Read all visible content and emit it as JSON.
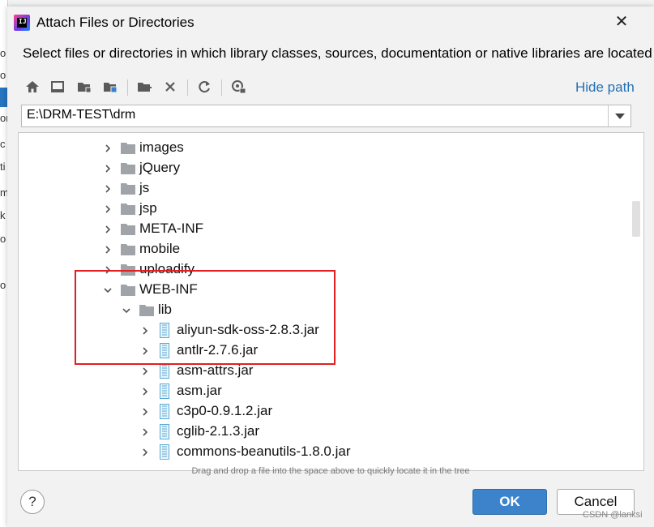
{
  "background": {
    "partial_letters": [
      "o",
      "o",
      "or",
      "c",
      "ti",
      "m",
      "k",
      "o",
      "o"
    ]
  },
  "dialog": {
    "title": "Attach Files or Directories",
    "close_glyph": "✕",
    "description": "Select files or directories in which library classes, sources, documentation or native libraries are located",
    "toolbar": {
      "icons": [
        "home-icon",
        "desktop-icon",
        "project-folder-icon",
        "module-folder-icon",
        "new-folder-icon",
        "delete-icon",
        "refresh-icon",
        "show-hidden-icon"
      ],
      "hide_path_label": "Hide path"
    },
    "path": {
      "value": "E:\\DRM-TEST\\drm"
    },
    "tree": {
      "rows": [
        {
          "label": "images",
          "type": "folder",
          "expanded": false
        },
        {
          "label": "jQuery",
          "type": "folder",
          "expanded": false
        },
        {
          "label": "js",
          "type": "folder",
          "expanded": false
        },
        {
          "label": "jsp",
          "type": "folder",
          "expanded": false
        },
        {
          "label": "META-INF",
          "type": "folder",
          "expanded": false
        },
        {
          "label": "mobile",
          "type": "folder",
          "expanded": false
        },
        {
          "label": "uploadify",
          "type": "folder",
          "expanded": false
        },
        {
          "label": "WEB-INF",
          "type": "folder",
          "expanded": true
        },
        {
          "label": "lib",
          "type": "folder",
          "expanded": true
        },
        {
          "label": "aliyun-sdk-oss-2.8.3.jar",
          "type": "jar",
          "expanded": false
        },
        {
          "label": "antlr-2.7.6.jar",
          "type": "jar",
          "expanded": false
        },
        {
          "label": "asm-attrs.jar",
          "type": "jar",
          "expanded": false
        },
        {
          "label": "asm.jar",
          "type": "jar",
          "expanded": false
        },
        {
          "label": "c3p0-0.9.1.2.jar",
          "type": "jar",
          "expanded": false
        },
        {
          "label": "cglib-2.1.3.jar",
          "type": "jar",
          "expanded": false
        },
        {
          "label": "commons-beanutils-1.8.0.jar",
          "type": "jar",
          "expanded": false
        }
      ]
    },
    "hint": "Drag and drop a file into the space above to quickly locate it in the tree",
    "help_label": "?",
    "ok_label": "OK",
    "cancel_label": "Cancel",
    "highlight_color": "#e02020"
  },
  "watermark": "CSDN @lanksi"
}
